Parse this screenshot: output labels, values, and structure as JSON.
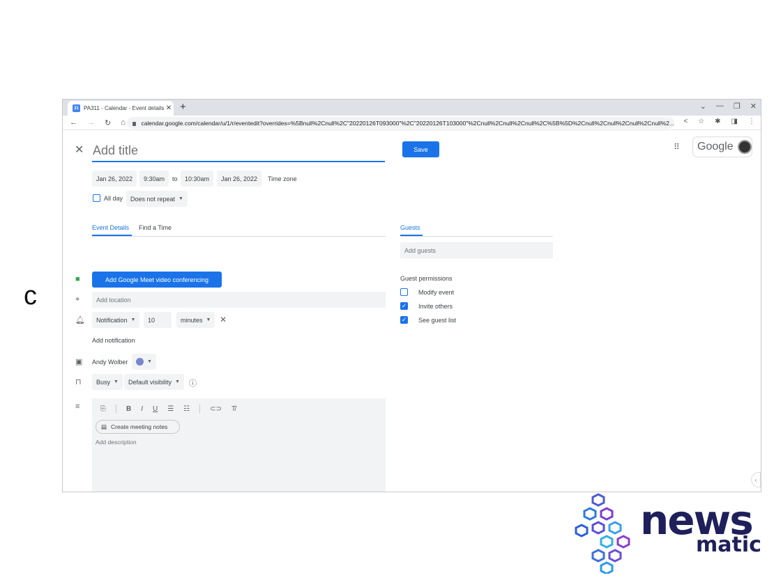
{
  "side_letter": "c",
  "browser": {
    "tab_title": "PA311 - Calendar - Event details",
    "tab_close": "✕",
    "new_tab": "+",
    "window_controls": [
      "⌄",
      "—",
      "❐",
      "✕"
    ],
    "url": "calendar.google.com/calendar/u/1/r/eventedit?overrides=%5Bnull%2Cnull%2C\"20220126T093000\"%2C\"20220126T103000\"%2Cnull%2Cnull%2Cnull%2C%5B%5D%2Cnull%2Cnull%2Cnull%2Cnull%2..."
  },
  "event": {
    "title_placeholder": "Add title",
    "save_label": "Save",
    "google_label": "Google",
    "start_date": "Jan 26, 2022",
    "start_time": "9:30am",
    "to_label": "to",
    "end_time": "10:30am",
    "end_date": "Jan 26, 2022",
    "time_zone": "Time zone",
    "all_day": "All day",
    "repeat": "Does not repeat"
  },
  "details": {
    "tab_event_details": "Event Details",
    "tab_find_time": "Find a Time",
    "meet_button": "Add Google Meet video conferencing",
    "location_placeholder": "Add location",
    "notification_type": "Notification",
    "notification_value": "10",
    "notification_unit": "minutes",
    "add_notification": "Add notification",
    "calendar_owner": "Andy Wolber",
    "calendar_color": "#7986cb",
    "busy": "Busy",
    "visibility": "Default visibility",
    "notes_button": "Create meeting notes",
    "description_placeholder": "Add description"
  },
  "guests": {
    "tab_label": "Guests",
    "add_placeholder": "Add guests",
    "permissions_title": "Guest permissions",
    "permissions": [
      {
        "label": "Modify event",
        "checked": false
      },
      {
        "label": "Invite others",
        "checked": true
      },
      {
        "label": "See guest list",
        "checked": true
      }
    ]
  },
  "logo": {
    "news": "news",
    "matic": "matic"
  },
  "colors": {
    "accent": "#1a73e8",
    "logo_text": "#1f1f5c"
  }
}
